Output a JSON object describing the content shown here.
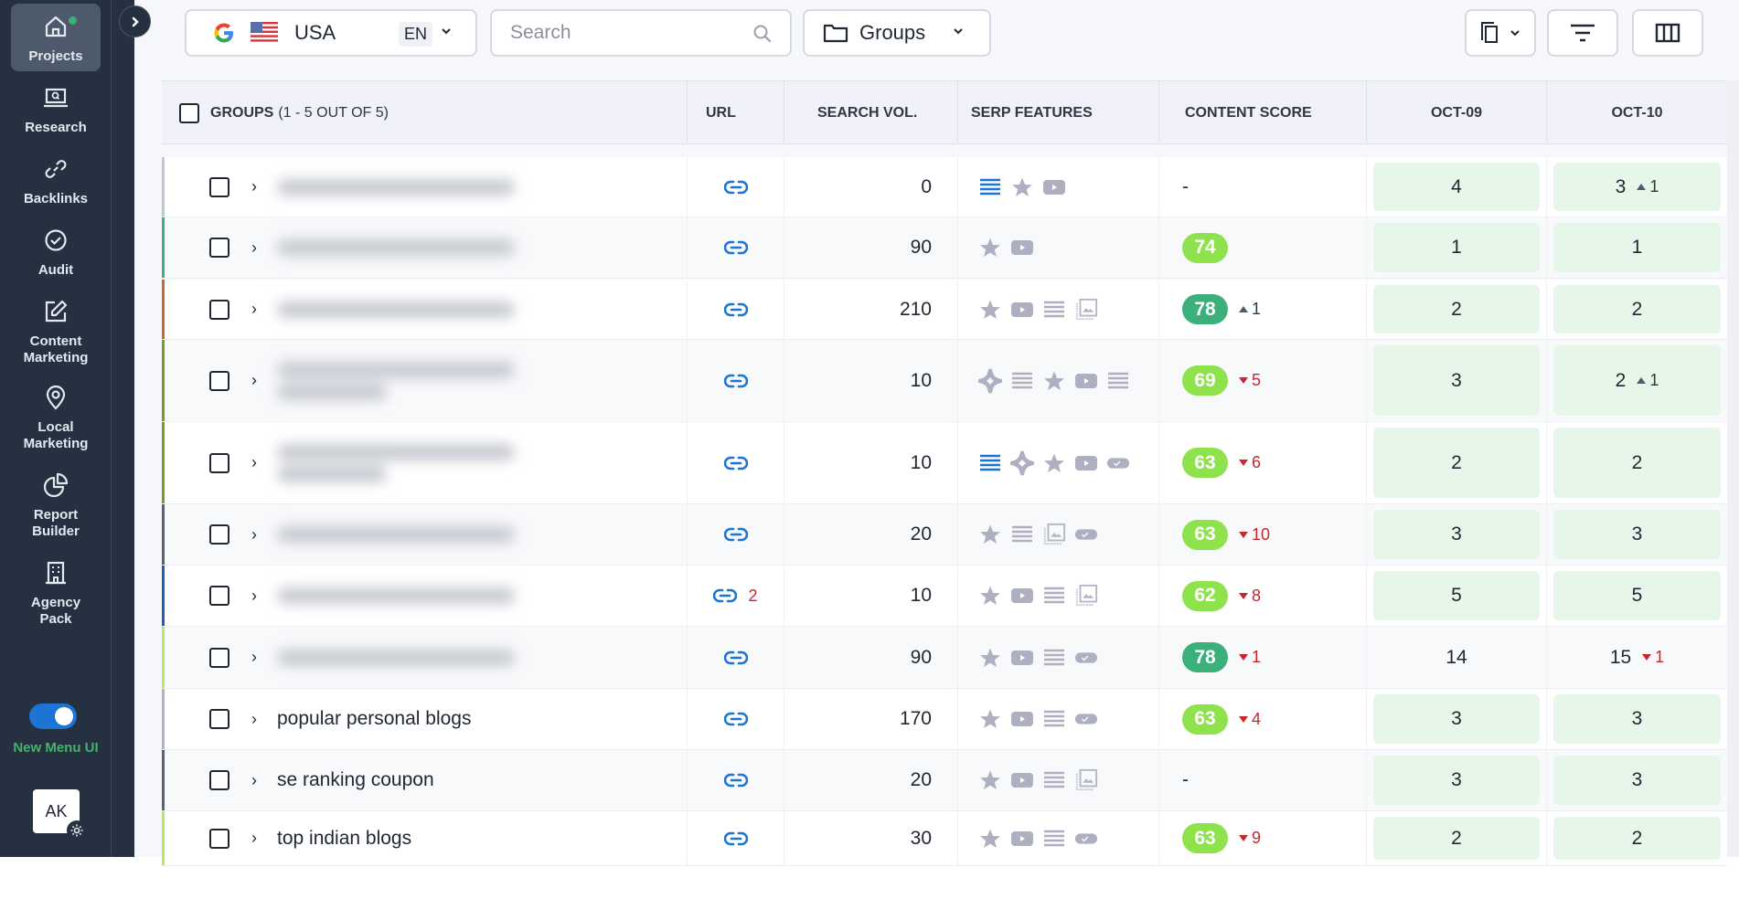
{
  "sidebar": {
    "items": [
      {
        "id": "projects",
        "label": "Projects",
        "icon": "home-icon",
        "active": true,
        "has_dot": true
      },
      {
        "id": "research",
        "label": "Research",
        "icon": "laptop-search-icon"
      },
      {
        "id": "backlinks",
        "label": "Backlinks",
        "icon": "link-icon"
      },
      {
        "id": "audit",
        "label": "Audit",
        "icon": "check-circle-icon"
      },
      {
        "id": "content-marketing",
        "label": "Content\nMarketing",
        "icon": "edit-icon"
      },
      {
        "id": "local-marketing",
        "label": "Local\nMarketing",
        "icon": "map-pin-icon"
      },
      {
        "id": "report-builder",
        "label": "Report\nBuilder",
        "icon": "pie-chart-icon"
      },
      {
        "id": "agency-pack",
        "label": "Agency\nPack",
        "icon": "building-icon"
      }
    ],
    "toggle": {
      "label": "New Menu UI",
      "on": true
    },
    "avatar": {
      "initials": "AK"
    }
  },
  "toolbar": {
    "search_engine": "Google",
    "country": "USA",
    "language": "EN",
    "search_placeholder": "Search",
    "search_value": "",
    "groups_label": "Groups",
    "buttons": [
      "copy-icon",
      "filter-icon",
      "columns-icon"
    ]
  },
  "table": {
    "headers": {
      "groups": "GROUPS",
      "groups_count": "(1 - 5 OUT OF 5)",
      "url": "URL",
      "search_vol": "SEARCH VOL.",
      "serp_features": "SERP FEATURES",
      "content_score": "CONTENT SCORE",
      "date1": "OCT-09",
      "date2": "OCT-10"
    },
    "colors": {
      "score_high": "#3bb07a",
      "score_mid": "#8ee24c",
      "position_bg": "#e6f7ea",
      "delta_down": "#c8262f",
      "link": "#1c74d4"
    },
    "rows": [
      {
        "keyword": "",
        "blurred": true,
        "blur_lines": 1,
        "border": "#c3c5d0",
        "url_count": "",
        "vol": "0",
        "serp": [
          "list-blue",
          "star",
          "video"
        ],
        "score": "-",
        "score_level": "",
        "score_delta": "",
        "score_dir": "",
        "d1": "4",
        "d1_green": true,
        "d2": "3",
        "d2_delta": "1",
        "d2_dir": "up",
        "d2_green": true
      },
      {
        "keyword": "",
        "blurred": true,
        "blur_lines": 1,
        "border": "#3bb07a",
        "url_count": "",
        "vol": "90",
        "serp": [
          "star",
          "video"
        ],
        "score": "74",
        "score_level": "mid",
        "score_delta": "",
        "score_dir": "",
        "d1": "1",
        "d1_green": true,
        "d2": "1",
        "d2_delta": "",
        "d2_dir": "",
        "d2_green": true
      },
      {
        "keyword": "",
        "blurred": true,
        "blur_lines": 1,
        "border": "#c06a35",
        "url_count": "",
        "vol": "210",
        "serp": [
          "star",
          "video",
          "list",
          "images"
        ],
        "score": "78",
        "score_level": "high",
        "score_delta": "1",
        "score_dir": "up",
        "d1": "2",
        "d1_green": true,
        "d2": "2",
        "d2_delta": "",
        "d2_dir": "",
        "d2_green": true
      },
      {
        "keyword": "",
        "blurred": true,
        "blur_lines": 2,
        "border": "#7a9a28",
        "url_count": "",
        "vol": "10",
        "serp": [
          "ai-overview",
          "list",
          "star",
          "video",
          "list"
        ],
        "score": "69",
        "score_level": "mid",
        "score_delta": "5",
        "score_dir": "down",
        "d1": "3",
        "d1_green": true,
        "d2": "2",
        "d2_delta": "1",
        "d2_dir": "up",
        "d2_green": true
      },
      {
        "keyword": "",
        "blurred": true,
        "blur_lines": 2,
        "border": "#7a9a28",
        "url_count": "",
        "vol": "10",
        "serp": [
          "list-blue",
          "ai-overview",
          "star",
          "video",
          "toggle"
        ],
        "score": "63",
        "score_level": "mid",
        "score_delta": "6",
        "score_dir": "down",
        "d1": "2",
        "d1_green": true,
        "d2": "2",
        "d2_delta": "",
        "d2_dir": "",
        "d2_green": true
      },
      {
        "keyword": "",
        "blurred": true,
        "blur_lines": 1,
        "border": "#566274",
        "url_count": "",
        "vol": "20",
        "serp": [
          "star",
          "list",
          "images",
          "toggle"
        ],
        "score": "63",
        "score_level": "mid",
        "score_delta": "10",
        "score_dir": "down",
        "d1": "3",
        "d1_green": true,
        "d2": "3",
        "d2_delta": "",
        "d2_dir": "",
        "d2_green": true
      },
      {
        "keyword": "",
        "blurred": true,
        "blur_lines": 1,
        "border": "#1f5fb8",
        "url_count": "2",
        "vol": "10",
        "serp": [
          "star",
          "video",
          "list",
          "images"
        ],
        "score": "62",
        "score_level": "mid",
        "score_delta": "8",
        "score_dir": "down",
        "d1": "5",
        "d1_green": true,
        "d2": "5",
        "d2_delta": "",
        "d2_dir": "",
        "d2_green": true
      },
      {
        "keyword": "",
        "blurred": true,
        "blur_lines": 1,
        "border": "#bde85a",
        "url_count": "",
        "vol": "90",
        "serp": [
          "star",
          "video",
          "list",
          "toggle"
        ],
        "score": "78",
        "score_level": "high",
        "score_delta": "1",
        "score_dir": "down",
        "d1": "14",
        "d1_green": false,
        "d2": "15",
        "d2_delta": "1",
        "d2_dir": "down",
        "d2_green": false
      },
      {
        "keyword": "popular personal blogs",
        "blurred": false,
        "border": "#b4b3c8",
        "url_count": "",
        "vol": "170",
        "serp": [
          "star",
          "video",
          "list",
          "toggle"
        ],
        "score": "63",
        "score_level": "mid",
        "score_delta": "4",
        "score_dir": "down",
        "d1": "3",
        "d1_green": true,
        "d2": "3",
        "d2_delta": "",
        "d2_dir": "",
        "d2_green": true
      },
      {
        "keyword": "se ranking coupon",
        "blurred": false,
        "border": "#566274",
        "url_count": "",
        "vol": "20",
        "serp": [
          "star",
          "video",
          "list",
          "images"
        ],
        "score": "-",
        "score_level": "",
        "score_delta": "",
        "score_dir": "",
        "d1": "3",
        "d1_green": true,
        "d2": "3",
        "d2_delta": "",
        "d2_dir": "",
        "d2_green": true
      },
      {
        "keyword": "top indian blogs",
        "blurred": false,
        "border": "#bde85a",
        "url_count": "",
        "vol": "30",
        "serp": [
          "star",
          "video",
          "list",
          "toggle"
        ],
        "score": "63",
        "score_level": "mid",
        "score_delta": "9",
        "score_dir": "down",
        "d1": "2",
        "d1_green": true,
        "d2": "2",
        "d2_delta": "",
        "d2_dir": "",
        "d2_green": true
      }
    ]
  }
}
